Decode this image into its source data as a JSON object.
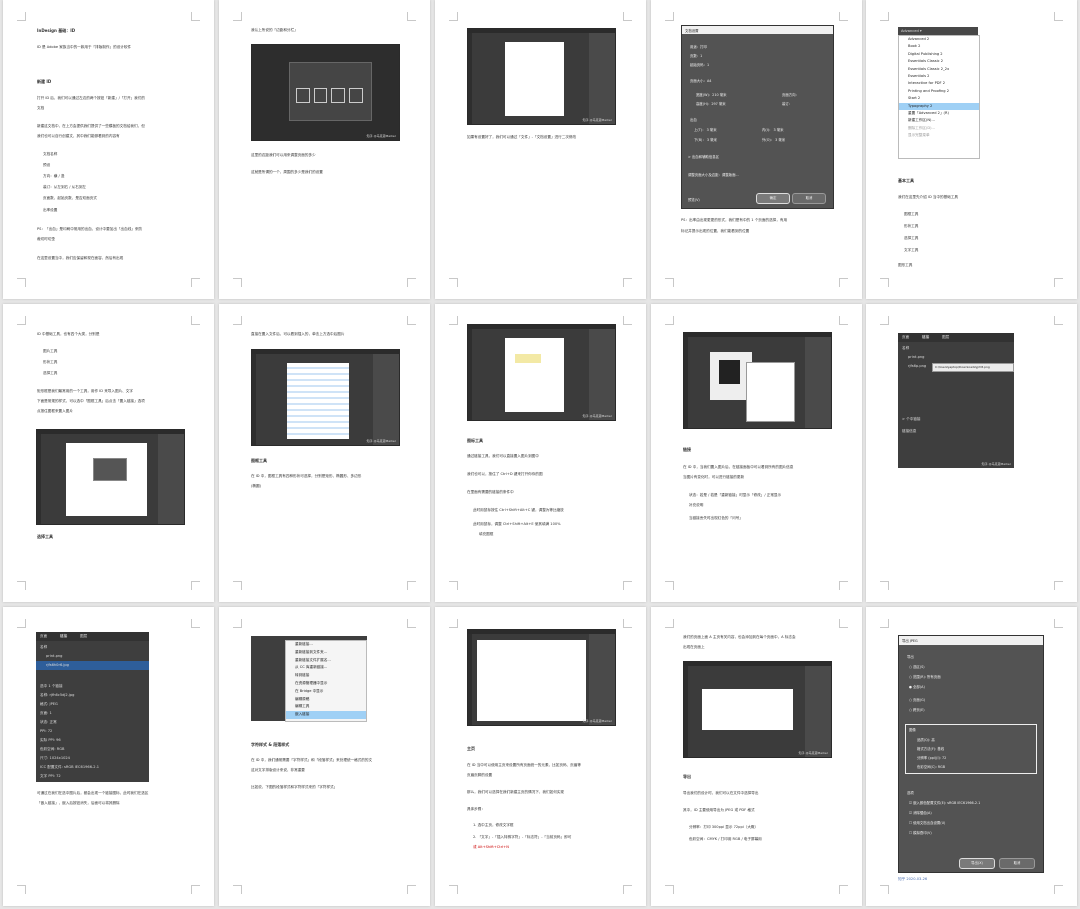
{
  "pages": [
    {
      "lines": [
        "InDesign 基础：ID",
        "ID 是 Adobe 家族当中的一款用于「排版制作」的设计软件",
        "新建 ID",
        "打开 ID 后，我们可以通过左边的两个按钮「新建」/「打开」我们的",
        "文档",
        "新建这文档中，在上方会提供我们提供了一些模板的文档给我们，但",
        "我们也可以自行创建文，其中我们能够看到的内容有",
        "文档名称",
        "预设",
        "方向：横 / 竖",
        "装订：从左到右 / 从右到左",
        "页面数、起始页数、是否双面页式",
        "出率设置",
        "PS：「出血」是印刷中常用的出血，设计中要加出「出血线」来防",
        "裁切时切歪",
        "在这里设置当中，我们应保留和现在面容，然后有出现"
      ]
    },
    {
      "lines": [
        "我认上所说的「边距和分栏」",
        "这里的边距我们可以用来调整页面的多少",
        "这就是所谓的一个，周围的多少是我们的设置"
      ],
      "watermark": "知乎 @马克思Marker"
    },
    {
      "lines": [
        "如果有设置好了，我们可以通过「文件」-「文档设置」进行二次修改"
      ],
      "watermark": "知乎 @马克思Marker"
    },
    {
      "dialog": {
        "title": "文档设置",
        "rows": [
          "用途：打印",
          "页数：1",
          "起始页码：1",
          "页面大小：A4",
          "宽度(W)：210 毫米",
          "高度(H)：297 毫米",
          "页面方向：",
          "装订：",
          "出血",
          "上(T)：  3 毫米",
          "下(B)：  3 毫米",
          "内(I)：  3 毫米",
          "外(O)：  3 毫米",
          "> 出血和辅助信息区",
          "调整页面大小及边距：调整版面..."
        ],
        "ok": "确定",
        "cancel": "取消",
        "preview": "预览(V)"
      },
      "lines": [
        "PS：出率由出现更更的形式，我们是有中的 1 个页面的选择，有用",
        "标记并提示出现的位置，我们能看到的位置"
      ]
    },
    {
      "menu": [
        "Advanced 2",
        "Book 2",
        "Digital Publishing 2",
        "Essentials Classic 2",
        "Essentials Classic 2_2x",
        "Essentials 2",
        "Interactive for PDF 2",
        "Printing and Proofing 2",
        "Start 2",
        "Typography 2",
        "重置「Advanced 2」(R)",
        "新建工作区(N)...",
        "删除工作区(D)...",
        "显示完整菜单"
      ],
      "menu_header": "Advanced ▾",
      "lines": [
        "基本工具",
        "我们在这里先介绍 ID 当中的基础工具",
        "图框工具",
        "形状工具",
        "选择工具",
        "文字工具",
        "图形工具"
      ]
    },
    {
      "lines": [
        "ID 中基础工具，也有四个大类，分别是",
        "图片工具",
        "形状工具",
        "选择工具",
        "矩形框是我们最常用的一个工具，用作 ID 来导入图片、文字",
        "下面是常规的样式，可以选中「图框工具」后点击「置入链接」选项",
        "点按住图框来置入图片"
      ]
    },
    {
      "lines": [
        "直接在置入文件后，可以看到插入的，单击上方选中后图片",
        "图框工具",
        "在 ID 中，图框工具有四种形状可选择，分别是矩形、椭圆形、多边形",
        "(椭圆)"
      ],
      "watermark": "知乎 @马克思Marker"
    },
    {
      "lines": [
        "图标工具",
        "通过链接工具，我们可以直接置入图片到图中",
        "我们也可以，按住了 Ctrl+D 键来打开你你的图",
        "在里面有需要的链接的条件中",
        "此时用鼠标按住 Ctrl+Shift+Alt+C 键，调整为等比缩放",
        "此时用鼠标，调整 Ctrl+Shift+Alt+E 使其填满 100%",
        "填充图框"
      ],
      "watermark": "知乎 @马克思Marker"
    },
    {
      "lines": [
        "链接",
        "在 ID 中，当我们置入图片后，在链接面板中可以看到所有的图片信息",
        "当图片有变化时，可以进行链接的更新",
        "状态：若是 / 若是「重新链接」时显示「修改」/ 正常显示",
        "补充说明",
        "当链接丢失时出现红色的「问号」"
      ],
      "watermark": "知乎 @马克思Marker"
    },
    {
      "panel_tabs": [
        "页面",
        "链接",
        "图层"
      ],
      "panel_rows": [
        "名称",
        "print.png",
        "rjfs6p.png"
      ],
      "path": "C:\\Users\\japtop\\Downloads\\jjrh8.png",
      "panel_footer": "> 个中链接",
      "lines2": [
        "链接信息"
      ],
      "watermark": "知乎 @马克思Marker"
    },
    {
      "panel_tabs": [
        "页面",
        "链接",
        "图层"
      ],
      "panel_rows": [
        "名称",
        "print.png",
        "rjfs6h0r6.jpg"
      ],
      "info": [
        "选中 1 个链接",
        "名称: rjfh6c5dj2.jpg",
        "格式: JPEG",
        "页面: 1",
        "状态: 正常",
        "PPI: 72",
        "实际 PPI: 96",
        "色彩空间: RGB",
        "尺寸: 1024x1024",
        "ICC 配置文件: sRGB IEC61966-2.1",
        "文字 PPI: 72"
      ],
      "lines": [
        "可通过在我们在选中图片后，都会出现一个链接图标，此时我们在选区",
        "「嵌入链接」，嵌入后按钮消失，后面可以将其删除"
      ],
      "watermark": "知乎 @马克思Marker"
    },
    {
      "menu": [
        "重新链接...",
        "重新链接到文件夹...",
        "重新链接文件扩展名...",
        "从 CC 库重新链接...",
        "转到链接",
        "在资源管理器中显示",
        "在 Bridge 中显示",
        "编辑原稿",
        "编辑工具",
        "嵌入链接"
      ],
      "lines": [
        "字符样式 & 段落样式",
        "在 ID 中，我们通常需要「字符样式」和「段落样式」来处理统一格式的的文",
        "这对文字排版设计来说，非常重要",
        "比如说，下图的段落样式和字符样式来的「字符样式」"
      ]
    },
    {
      "lines": [
        "主页",
        "在 ID 当中可以使用主页来设置所有页面统一的元素，比如页码、页眉等",
        "页眉页脚的设置",
        "那么，我们可以选择在我们新建主页的情况下，我们如何实现",
        "具体步骤：",
        "1. 选中主页，修改文字框",
        "2. 「文字」-「插入特殊字符」-「标志符」-「当前页码」即可",
        "   或 Alt+Shift+Ctrl+N"
      ],
      "watermark": "知乎 @马克思Marker"
    },
    {
      "lines": [
        "我们的页面上面 A 主页有关内容，也会添加到在每个页面中，A 标志会",
        "出现在页面上",
        "导出",
        "导出我们的设计时，我们可以在文件中选择导出",
        "其中，ID 主要使用导出为 JPEG 或 PDF 格式",
        "分辨率：打印 300ppi 显示 72ppi（大概）",
        "色彩空间：CMYK / 打印用 RGB / 电子屏幕用"
      ],
      "watermark": "知乎 @马克思Marker"
    },
    {
      "dialog": {
        "title": "导出 JPEG",
        "rows": [
          "导出",
          "○ 选区(S)",
          "○ 范围(R): 所有页面",
          "● 全部(A)",
          "○ 页面(G)",
          "○ 跨页(E)",
          "图像",
          "品质(Q): 高",
          "格式方法(F): 基线",
          "分辨率 (ppi)(I): 72",
          "色彩空间(C): RGB",
          "选项",
          "☑ 嵌入颜色配置文件(E): sRGB IEC61966-2.1",
          "☑ 消除锯齿(A)",
          "☐ 使用文档出血设置(U)",
          "☐ 模拟叠印(V)"
        ],
        "ok": "导出(X)",
        "cancel": "取消"
      },
      "lines": [
        "知乎 2020-03-26"
      ]
    }
  ]
}
